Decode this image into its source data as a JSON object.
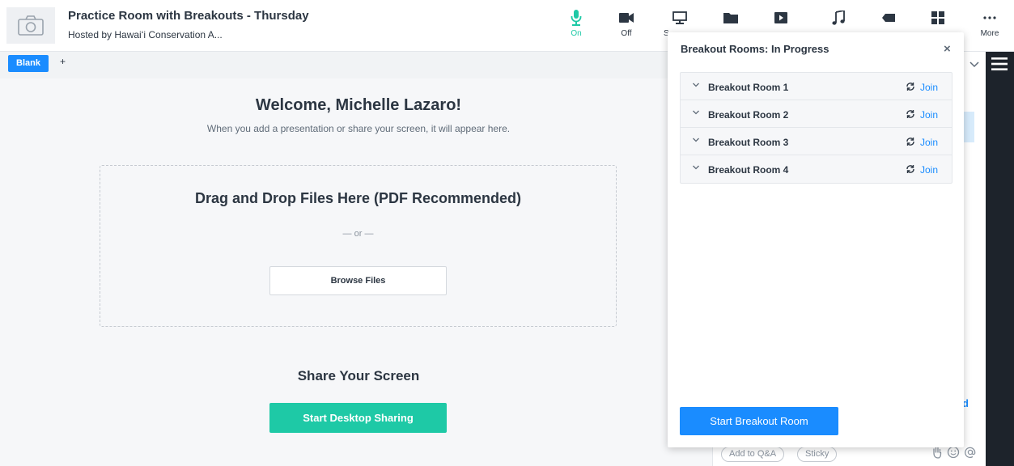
{
  "header": {
    "title": "Practice Room with Breakouts - Thursday",
    "host": "Hosted by Hawaiʻi Conservation A...",
    "toolbar": [
      {
        "icon": "microphone-icon",
        "label": "On",
        "color": "#1ec9a6"
      },
      {
        "icon": "camera-icon",
        "label": "Off"
      },
      {
        "icon": "monitor-icon",
        "label": "S"
      },
      {
        "icon": "folder-icon",
        "label": ""
      },
      {
        "icon": "play-icon",
        "label": ""
      },
      {
        "icon": "music-icon",
        "label": ""
      },
      {
        "icon": "tag-icon",
        "label": ""
      },
      {
        "icon": "grid-icon",
        "label": ""
      },
      {
        "icon": "more-icon",
        "label": "More"
      }
    ]
  },
  "tabs": {
    "active": "Blank",
    "add": "+"
  },
  "stage": {
    "welcome_title": "Welcome, Michelle Lazaro!",
    "welcome_sub": "When you add a presentation or share your screen, it will appear here.",
    "dropzone_title": "Drag and Drop Files Here (PDF Recommended)",
    "dropzone_or": "— or —",
    "browse_label": "Browse Files",
    "share_title": "Share Your Screen",
    "share_button": "Start Desktop Sharing"
  },
  "breakout": {
    "title": "Breakout Rooms: In Progress",
    "close": "×",
    "rooms": [
      {
        "name": "Breakout Room 1",
        "action": "Join"
      },
      {
        "name": "Breakout Room 2",
        "action": "Join"
      },
      {
        "name": "Breakout Room 3",
        "action": "Join"
      },
      {
        "name": "Breakout Room 4",
        "action": "Join"
      }
    ],
    "start_button": "Start Breakout Room"
  },
  "right_panel": {
    "partial_link": "d",
    "add_qa": "Add to Q&A",
    "sticky": "Sticky"
  },
  "colors": {
    "accent_blue": "#1a8cff",
    "accent_green": "#1ec9a6",
    "dark_sidebar": "#1d232b"
  }
}
